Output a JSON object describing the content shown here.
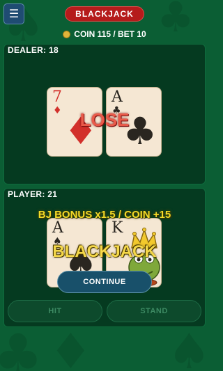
{
  "header": {
    "menu_icon": "hamburger-menu-icon",
    "title": "BLACKJACK",
    "coin_icon": "coin-icon",
    "coin_bet_text": "COIN 115 / BET 10"
  },
  "dealer": {
    "label": "DEALER: 18",
    "cards": [
      {
        "rank": "7",
        "suit": "♦",
        "suit_name": "diamonds",
        "color": "red"
      },
      {
        "rank": "A",
        "suit": "♣",
        "suit_name": "clubs",
        "color": "black"
      }
    ],
    "result": "LOSE"
  },
  "player": {
    "label": "PLAYER: 21",
    "bonus_text": "BJ BONUS x1.5 / COIN +15",
    "cards": [
      {
        "rank": "A",
        "suit": "♠",
        "suit_name": "spades",
        "color": "black"
      },
      {
        "rank": "K",
        "suit": "♚",
        "suit_name": "king-frog-illustration",
        "color": "black"
      }
    ],
    "result": "BLACKJACK"
  },
  "buttons": {
    "continue": "CONTINUE",
    "hit": "HIT",
    "stand": "STAND"
  },
  "colors": {
    "felt": "#0b5e34",
    "panel": "#053a20",
    "title_badge": "#b51b1b",
    "lose": "#ea5a4a",
    "blackjack": "#f5d84a",
    "bonus": "#f2da28"
  }
}
